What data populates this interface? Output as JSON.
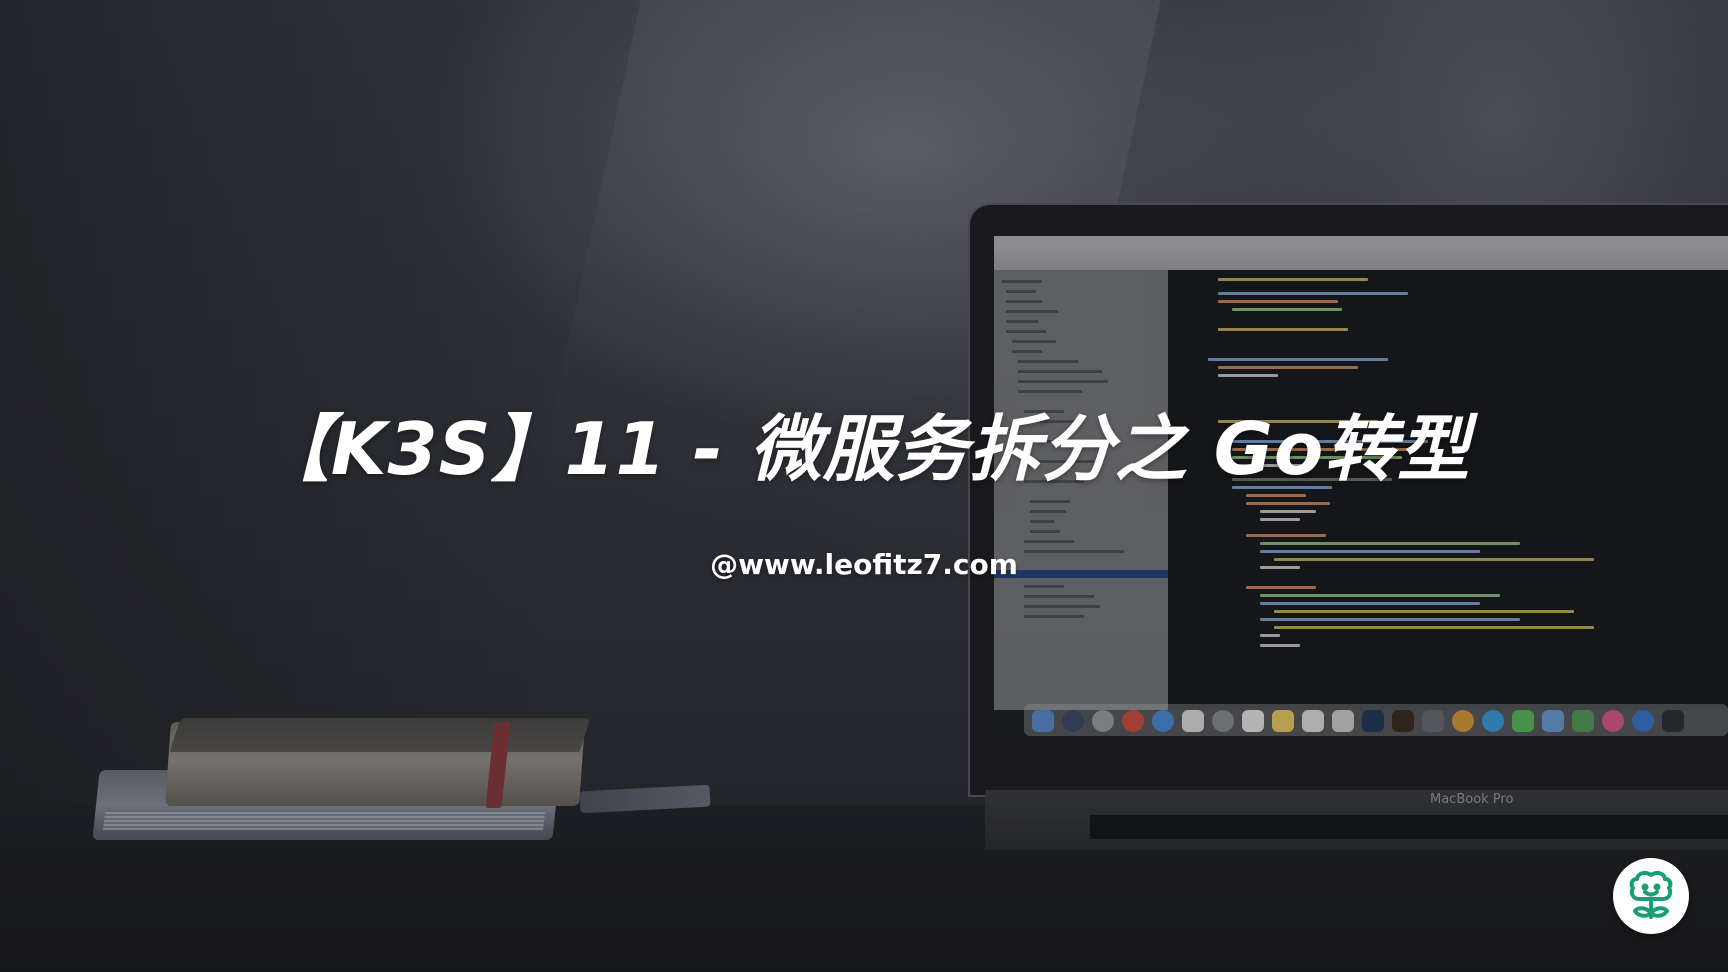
{
  "hero": {
    "title": "【K3S】11 - 微服务拆分之 Go转型",
    "subtitle": "@www.leofitz7.com"
  },
  "background": {
    "laptop_label": "MacBook Pro"
  },
  "badge": {
    "icon": "smiling-sprout-icon",
    "color": "#1a9e75"
  },
  "colors": {
    "title": "#ffffff",
    "badge_bg": "#ffffff",
    "badge_fg": "#1a9e75"
  }
}
